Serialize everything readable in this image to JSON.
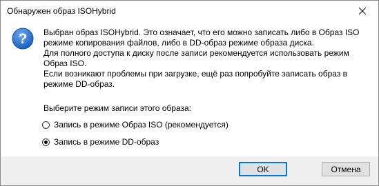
{
  "window": {
    "title": "Обнаружен образ ISOHybrid"
  },
  "message": {
    "lines": [
      "Выбран образ ISOHybrid. Это означает, что его можно записать либо в Образ ISO",
      "режиме копирования файлов, либо в DD-образ режиме образа диска.",
      "Для полного доступа к диску после записи рекомендуется использовать режим",
      "Образ ISO.",
      "Если возникают проблемы при загрузке, ещё раз попробуйте записать образ в",
      "режиме DD-образ."
    ],
    "prompt": "Выберите режим записи этого образа:"
  },
  "options": [
    {
      "label": "Запись в режиме Образ ISO (рекомендуется)",
      "selected": false
    },
    {
      "label": "Запись в режиме DD-образ",
      "selected": true
    }
  ],
  "buttons": {
    "ok": "OK",
    "cancel": "Отмена"
  },
  "colors": {
    "icon_blue": "#1e6fd0",
    "accent": "#0078d7",
    "footer_bg": "#f0f0f0"
  },
  "icons": {
    "dialog": "question-icon",
    "close": "close-icon"
  }
}
